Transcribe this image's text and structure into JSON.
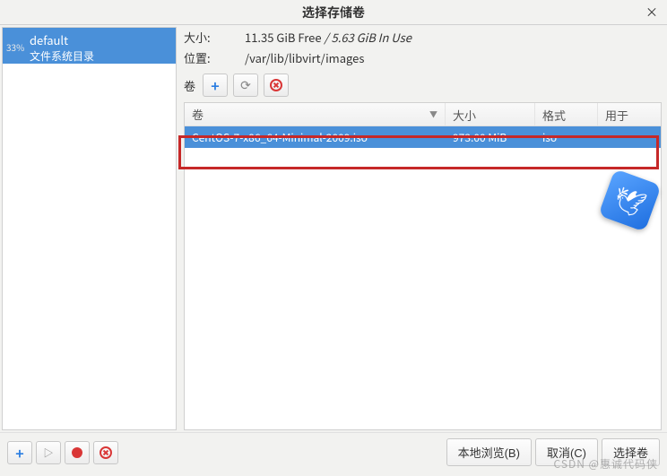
{
  "title": "选择存储卷",
  "close_glyph": "×",
  "sidebar": {
    "pools": [
      {
        "percent": "33%",
        "name": "default",
        "subtitle": "文件系统目录"
      }
    ]
  },
  "info": {
    "size_label": "大小:",
    "size_free": "11.35 GiB Free",
    "size_sep": " / ",
    "size_used": "5.63 GiB In Use",
    "location_label": "位置:",
    "location_value": "/var/lib/libvirt/images"
  },
  "volume_toolbar": {
    "label": "卷",
    "add_glyph": "+",
    "refresh_glyph": "⟳"
  },
  "columns": {
    "name": "卷",
    "size": "大小",
    "format": "格式",
    "used": "用于",
    "sort_glyph": "▼"
  },
  "volumes": [
    {
      "name": "CentOS-7-x86_64-Minimal-2009.iso",
      "size": "973.00 MiB",
      "format": "iso",
      "used": ""
    }
  ],
  "pool_toolbar": {
    "add_glyph": "+",
    "play_glyph": "▷"
  },
  "footer": {
    "browse": "本地浏览(B)",
    "cancel": "取消(C)",
    "choose": "选择卷"
  },
  "watermark": "CSDN @惠诚代码侠"
}
